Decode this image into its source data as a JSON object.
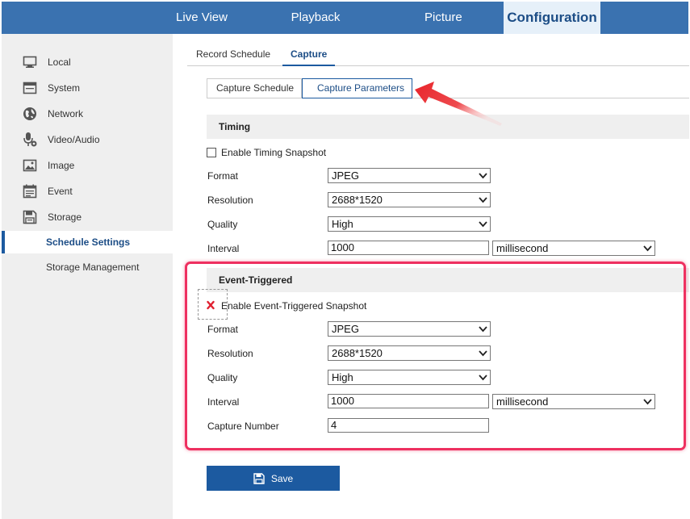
{
  "topnav": {
    "items": [
      "Live View",
      "Playback",
      "Picture",
      "Configuration"
    ],
    "active": "Configuration"
  },
  "sidebar": {
    "items": [
      {
        "label": "Local",
        "icon": "monitor-icon"
      },
      {
        "label": "System",
        "icon": "system-window-icon"
      },
      {
        "label": "Network",
        "icon": "globe-icon"
      },
      {
        "label": "Video/Audio",
        "icon": "microphone-icon"
      },
      {
        "label": "Image",
        "icon": "image-icon"
      },
      {
        "label": "Event",
        "icon": "calendar-icon"
      },
      {
        "label": "Storage",
        "icon": "floppy-disk-icon"
      }
    ],
    "subitems": [
      {
        "label": "Schedule Settings",
        "active": true
      },
      {
        "label": "Storage Management",
        "active": false
      }
    ]
  },
  "tabs": [
    "Record Schedule",
    "Capture"
  ],
  "active_tab": "Capture",
  "subtabs": [
    "Capture Schedule",
    "Capture Parameters"
  ],
  "active_subtab": "Capture Parameters",
  "timing": {
    "header": "Timing",
    "enable_label": "Enable Timing Snapshot",
    "enabled": false,
    "format_label": "Format",
    "format_value": "JPEG",
    "resolution_label": "Resolution",
    "resolution_value": "2688*1520",
    "quality_label": "Quality",
    "quality_value": "High",
    "interval_label": "Interval",
    "interval_value": "1000",
    "interval_unit": "millisecond"
  },
  "event": {
    "header": "Event-Triggered",
    "enable_label": "Enable Event-Triggered Snapshot",
    "enabled": false,
    "format_label": "Format",
    "format_value": "JPEG",
    "resolution_label": "Resolution",
    "resolution_value": "2688*1520",
    "quality_label": "Quality",
    "quality_value": "High",
    "interval_label": "Interval",
    "interval_value": "1000",
    "interval_unit": "millisecond",
    "capture_number_label": "Capture Number",
    "capture_number_value": "4"
  },
  "save_label": "Save",
  "colors": {
    "topbar": "#3a72b0",
    "accent": "#1c5aa0",
    "highlight": "#ee3060",
    "arrow": "#e8242a"
  }
}
